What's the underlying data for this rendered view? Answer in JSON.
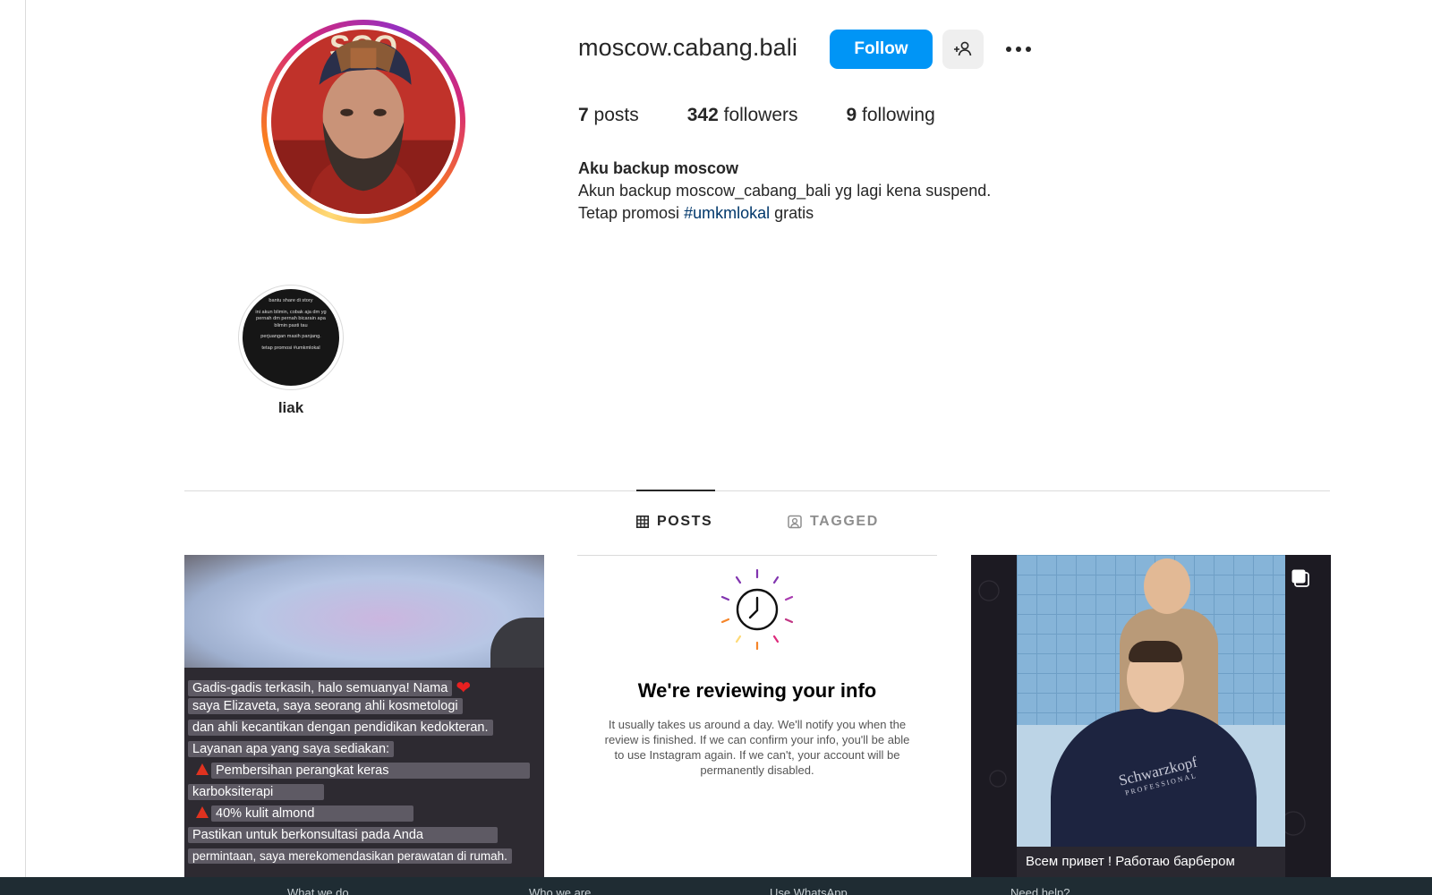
{
  "profile": {
    "username": "moscow.cabang.bali",
    "follow_label": "Follow",
    "stats": [
      {
        "count": "7",
        "label": "posts"
      },
      {
        "count": "342",
        "label": "followers"
      },
      {
        "count": "9",
        "label": "following"
      }
    ],
    "bio": {
      "name": "Aku backup moscow",
      "line1": "Akun backup moscow_cabang_bali yg lagi kena suspend.",
      "line2_before": "Tetap promosi ",
      "hashtag": "#umkmlokal",
      "line2_after": " gratis"
    },
    "avatar_text": "SCO"
  },
  "highlights": [
    {
      "label": "liak",
      "cover_lines": [
        "bantu share di story",
        "ini akun blimin, cobak aja dm yg pernah dm pernah bicarain apa blimin pasti tau",
        "perjuangan masih panjang.",
        "tetap promosi #umkmlokal"
      ]
    }
  ],
  "tabs": [
    {
      "label": "POSTS",
      "active": true,
      "icon": "grid-icon"
    },
    {
      "label": "TAGGED",
      "active": false,
      "icon": "tagged-icon"
    }
  ],
  "posts": {
    "p1": {
      "lines": [
        "Gadis-gadis terkasih, halo semuanya! Nama",
        "saya Elizaveta, saya seorang ahli kosmetologi",
        "dan ahli kecantikan dengan pendidikan kedokteran.",
        "Layanan apa yang saya sediakan:",
        "Pembersihan perangkat keras",
        "karboksiterapi",
        "40% kulit almond",
        "Pastikan untuk berkonsultasi pada Anda",
        "permintaan, saya merekomendasikan perawatan di rumah."
      ]
    },
    "p2": {
      "title": "We're reviewing your info",
      "body": "It usually takes us around a day. We'll notify you when the review is finished. If we can confirm your info, you'll be able to use Instagram again. If we can't, your account will be permanently disabled."
    },
    "p3": {
      "brand": "Schwarzkopf",
      "brand_sub": "PROFESSIONAL",
      "subtitle": "Всем привет ! Работаю барбером"
    }
  },
  "footer": {
    "links": [
      "What we do",
      "Who we are",
      "Use WhatsApp",
      "Need help?"
    ]
  },
  "colors": {
    "primary_button": "#0095f6",
    "hashtag": "#00376b",
    "footer_bg": "#1f2c33"
  }
}
